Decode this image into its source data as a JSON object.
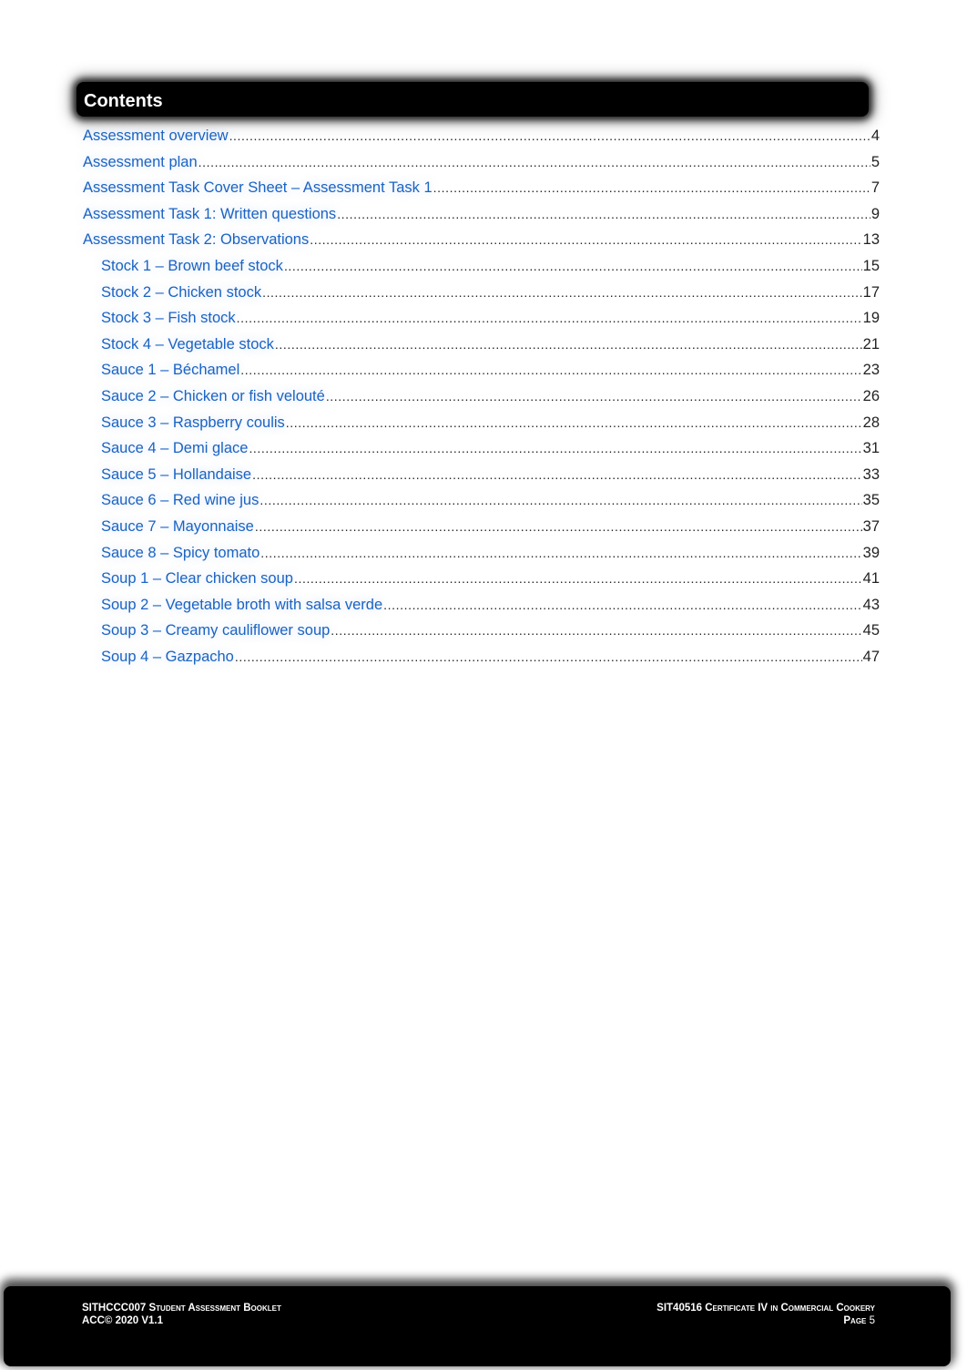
{
  "heading": {
    "title": "Contents"
  },
  "toc": {
    "entries": [
      {
        "label": "Assessment overview",
        "page": "4",
        "level": 1
      },
      {
        "label": "Assessment plan",
        "page": "5",
        "level": 1
      },
      {
        "label": "Assessment Task Cover Sheet – Assessment Task 1",
        "page": "7",
        "level": 1
      },
      {
        "label": "Assessment Task 1: Written questions",
        "page": "9",
        "level": 1
      },
      {
        "label": "Assessment Task 2: Observations",
        "page": "13",
        "level": 1
      },
      {
        "label": "Stock 1 – Brown beef stock",
        "page": "15",
        "level": 2
      },
      {
        "label": "Stock 2 – Chicken stock",
        "page": "17",
        "level": 2
      },
      {
        "label": "Stock 3 – Fish stock",
        "page": "19",
        "level": 2
      },
      {
        "label": "Stock 4 – Vegetable stock",
        "page": "21",
        "level": 2
      },
      {
        "label": "Sauce 1 – Béchamel",
        "page": "23",
        "level": 2
      },
      {
        "label": "Sauce 2 – Chicken or fish velouté",
        "page": "26",
        "level": 2
      },
      {
        "label": "Sauce 3 – Raspberry coulis",
        "page": "28",
        "level": 2
      },
      {
        "label": "Sauce 4 – Demi glace",
        "page": "31",
        "level": 2
      },
      {
        "label": "Sauce 5 – Hollandaise",
        "page": "33",
        "level": 2
      },
      {
        "label": "Sauce 6 – Red wine jus",
        "page": "35",
        "level": 2
      },
      {
        "label": "Sauce 7 – Mayonnaise",
        "page": "37",
        "level": 2
      },
      {
        "label": "Sauce 8 – Spicy tomato",
        "page": "39",
        "level": 2
      },
      {
        "label": "Soup 1 – Clear chicken soup",
        "page": "41",
        "level": 2
      },
      {
        "label": "Soup 2 – Vegetable broth with salsa verde",
        "page": "43",
        "level": 2
      },
      {
        "label": "Soup 3 – Creamy cauliflower soup",
        "page": "45",
        "level": 2
      },
      {
        "label": "Soup 4 – Gazpacho",
        "page": "47",
        "level": 2
      }
    ]
  },
  "footer": {
    "left_line1": "SITHCCC007 Student Assessment Booklet",
    "left_line2": "ACC© 2020 V1.1",
    "right_line1": "SIT40516 Certificate IV in Commercial Cookery",
    "right_page_label": "Page",
    "right_page_number": "5"
  },
  "colors": {
    "link": "#1a63c3",
    "bar": "#000000",
    "text": "#222222"
  }
}
